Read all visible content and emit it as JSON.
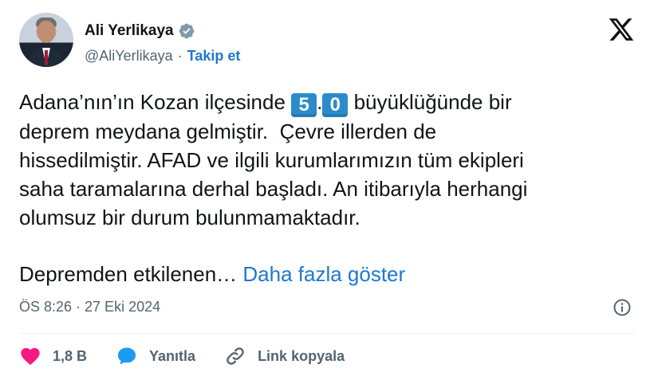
{
  "author": {
    "name": "Ali Yerlikaya",
    "handle": "@AliYerlikaya",
    "separator": "·",
    "follow_label": "Takip et"
  },
  "tweet": {
    "line1_before": "Adana’nın’ın Kozan ilçesinde ",
    "digit1": "5",
    "dot": ".",
    "digit2": "0",
    "line1_after": " büyüklüğünde bir",
    "rest": "deprem meydana gelmiştir.  Çevre illerden de\nhissedilmiştir. AFAD ve ilgili kurumlarımızın tüm ekipleri\nsaha taramalarına derhal başladı. An itibarıyla herhangi\nolumsuz bir durum bulunmamaktadır.",
    "truncated": "Depremden etkilenen…",
    "more_label": "Daha fazla göster"
  },
  "meta": {
    "timestamp": "ÖS 8:26 · 27 Eki 2024"
  },
  "actions": {
    "like_count": "1,8 B",
    "reply_label": "Yanıtla",
    "copy_link_label": "Link kopyala"
  },
  "colors": {
    "accent": "#1d78d1",
    "like": "#f91880",
    "reply": "#1d9bf0",
    "keycap": "#2b8ccc",
    "muted": "#536471"
  },
  "icons": [
    "verified-badge-icon",
    "x-logo-icon",
    "info-icon",
    "heart-icon",
    "reply-bubble-icon",
    "link-icon"
  ]
}
